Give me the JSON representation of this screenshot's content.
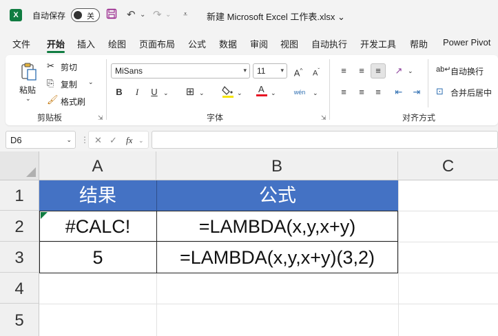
{
  "titlebar": {
    "autosave_label": "自动保存",
    "autosave_state": "关",
    "doc_title": "新建 Microsoft Excel 工作表.xlsx ⌄"
  },
  "tabs": [
    "文件",
    "开始",
    "插入",
    "绘图",
    "页面布局",
    "公式",
    "数据",
    "审阅",
    "视图",
    "自动执行",
    "开发工具",
    "帮助",
    "Power Pivot"
  ],
  "ribbon": {
    "clipboard": {
      "paste": "粘贴",
      "cut": "剪切",
      "copy": "复制",
      "format_painter": "格式刷",
      "group": "剪贴板"
    },
    "font": {
      "font_name": "MiSans",
      "font_size": "11",
      "bold": "B",
      "italic": "I",
      "underline": "U",
      "group": "字体"
    },
    "alignment": {
      "wrap_text": "自动换行",
      "merge_center": "合并后居中",
      "group": "对齐方式"
    }
  },
  "formula_bar": {
    "name_box": "D6",
    "fx": "fx",
    "formula": ""
  },
  "sheet": {
    "columns": [
      "A",
      "B",
      "C"
    ],
    "rows": [
      "1",
      "2",
      "3",
      "4",
      "5"
    ],
    "cells": {
      "A1": "结果",
      "B1": "公式",
      "A2": "#CALC!",
      "B2": "=LAMBDA(x,y,x+y)",
      "A3": "5",
      "B3": "=LAMBDA(x,y,x+y)(3,2)"
    },
    "header_fill": "#4472c4",
    "header_text_color": "#ffffff"
  },
  "colors": {
    "accent": "#107c41"
  }
}
